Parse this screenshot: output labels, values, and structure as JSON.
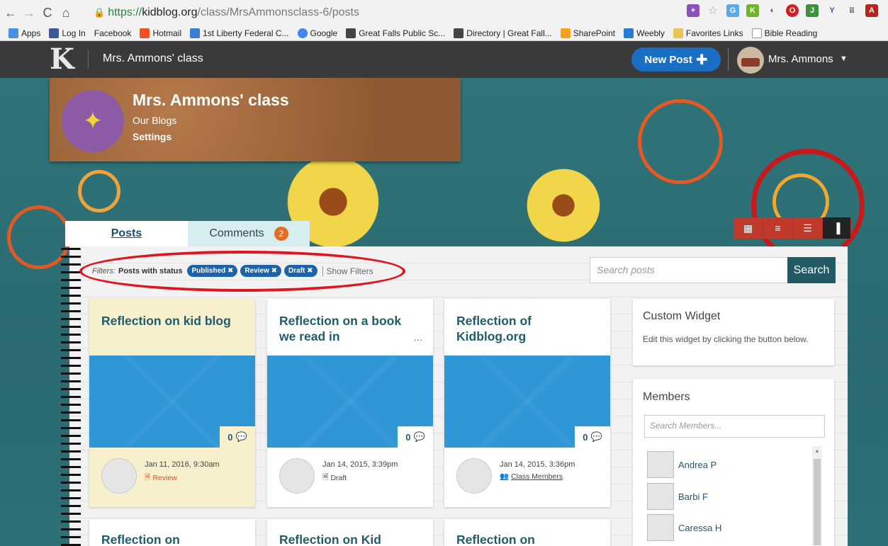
{
  "browser": {
    "url_scheme": "https://",
    "url_domain": "kidblog.org",
    "url_path": "/class/MrsAmmonsclass-6/posts",
    "bookmarks": [
      "Apps",
      "Log In",
      "Facebook",
      "Hotmail",
      "1st Liberty Federal C...",
      "Google",
      "Great Falls Public Sc...",
      "Directory | Great Fall...",
      "SharePoint",
      "Weebly",
      "Favorites Links",
      "Bible Reading"
    ]
  },
  "header": {
    "logo": "K",
    "class_title": "Mrs. Ammons' class",
    "new_post_label": "New Post",
    "user_name": "Mrs. Ammons"
  },
  "banner": {
    "title": "Mrs. Ammons' class",
    "link_blogs": "Our Blogs",
    "link_settings": "Settings"
  },
  "tabs": {
    "posts": "Posts",
    "comments": "Comments",
    "comments_count": "2"
  },
  "filters": {
    "label": "Filters:",
    "status_label": "Posts with status",
    "pills": [
      "Published ✖",
      "Review ✖",
      "Draft ✖"
    ],
    "show_filters": "Show Filters"
  },
  "search": {
    "placeholder": "Search posts",
    "button": "Search"
  },
  "posts": [
    {
      "title": "Reflection on kid blog",
      "comments": "0",
      "date": "Jan 11, 2016, 9:30am",
      "status": "Review",
      "status_color": "#d9531e"
    },
    {
      "title": "Reflection on a book we read in",
      "comments": "0",
      "date": "Jan 14, 2015, 3:39pm",
      "status": "Draft",
      "status_color": "#444444"
    },
    {
      "title": "Reflection of Kidblog.org",
      "comments": "0",
      "date": "Jan 14, 2015, 3:36pm",
      "status": "Class Members",
      "status_color": "#444444"
    }
  ],
  "posts_row2": [
    "Reflection on",
    "Reflection on Kid",
    "Reflection on"
  ],
  "widget_custom": {
    "title": "Custom Widget",
    "body": "Edit this widget by clicking the button below."
  },
  "widget_members": {
    "title": "Members",
    "search_placeholder": "Search Members...",
    "members": [
      "Andrea P",
      "Barbi F",
      "Caressa H"
    ]
  },
  "colors": {
    "accent": "#1a6fc4",
    "header": "#3a3a3a",
    "card_image": "#2f97d5",
    "highlight_circle": "#e0151f"
  }
}
